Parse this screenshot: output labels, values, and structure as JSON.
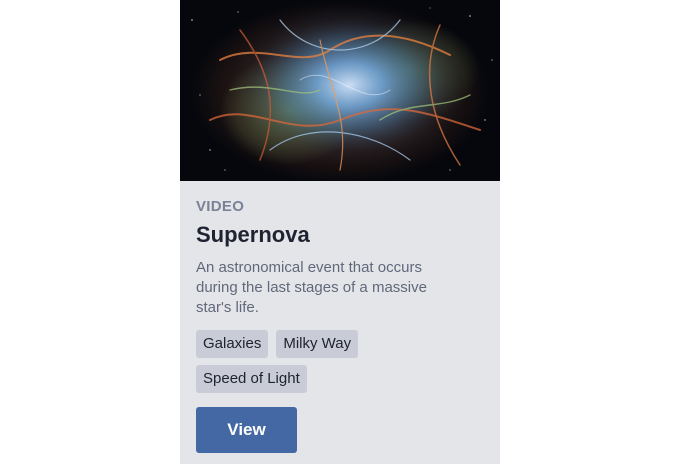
{
  "card": {
    "image_alt": "Supernova nebula image",
    "category": "VIDEO",
    "title": "Supernova",
    "description": "An astronomical event that occurs during the last stages of a massive star's life.",
    "tags": [
      "Galaxies",
      "Milky Way",
      "Speed of Light"
    ],
    "action_label": "View"
  },
  "colors": {
    "card_background": "#e3e5e9",
    "tag_background": "#c9ccd6",
    "button_background": "#4468a3",
    "category_text": "#7b8197"
  }
}
